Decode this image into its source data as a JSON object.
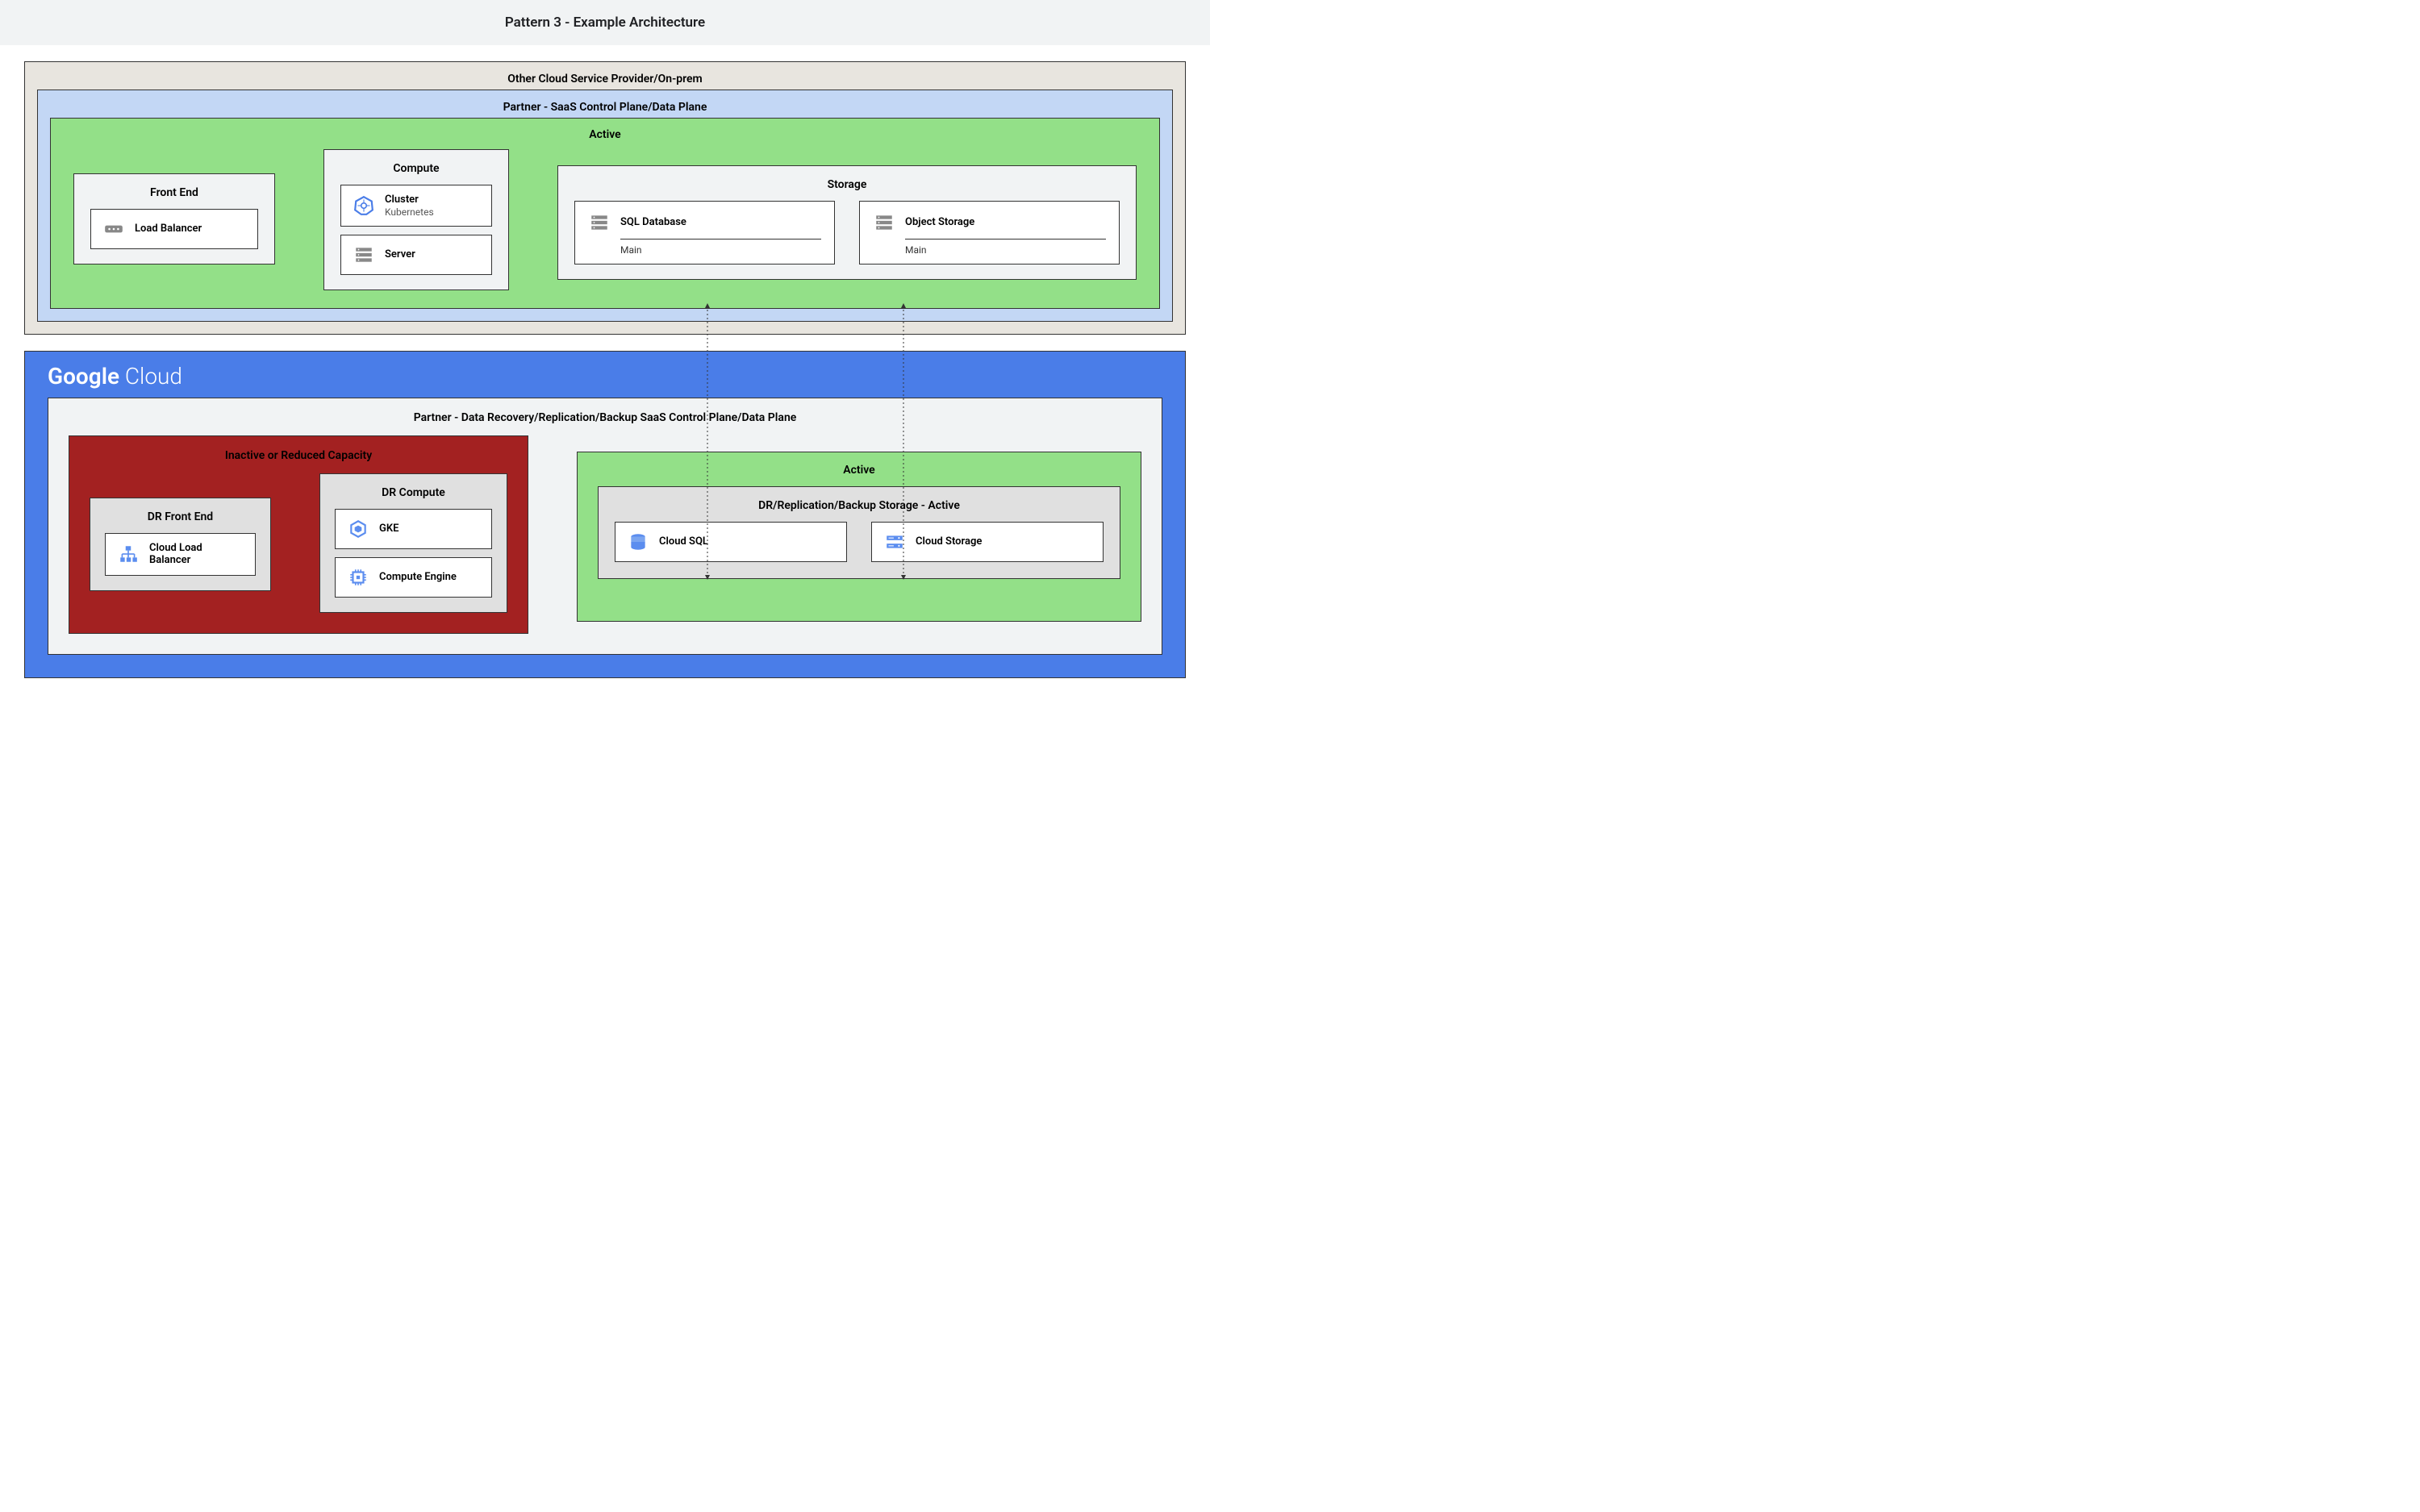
{
  "header": "Pattern 3 - Example Architecture",
  "top": {
    "other_cloud": "Other Cloud Service Provider/On-prem",
    "partner_saas": "Partner - SaaS Control Plane/Data Plane",
    "active": "Active",
    "front_end": {
      "title": "Front End",
      "load_balancer": "Load Balancer"
    },
    "compute": {
      "title": "Compute",
      "cluster": "Cluster",
      "cluster_sub": "Kubernetes",
      "server": "Server"
    },
    "storage": {
      "title": "Storage",
      "sql": "SQL Database",
      "sql_sub": "Main",
      "object": "Object Storage",
      "object_sub": "Main"
    }
  },
  "bottom": {
    "gc_logo_bold": "Google",
    "gc_logo_light": " Cloud",
    "partner_dr": "Partner - Data Recovery/Replication/Backup SaaS Control Plane/Data Plane",
    "inactive": {
      "title": "Inactive or Reduced Capacity",
      "front_end": {
        "title": "DR Front End",
        "clb": "Cloud Load Balancer"
      },
      "compute": {
        "title": "DR Compute",
        "gke": "GKE",
        "ce": "Compute Engine"
      }
    },
    "active": {
      "title": "Active",
      "storage": {
        "title": "DR/Replication/Backup Storage - Active",
        "cloud_sql": "Cloud SQL",
        "cloud_storage": "Cloud Storage"
      }
    }
  }
}
